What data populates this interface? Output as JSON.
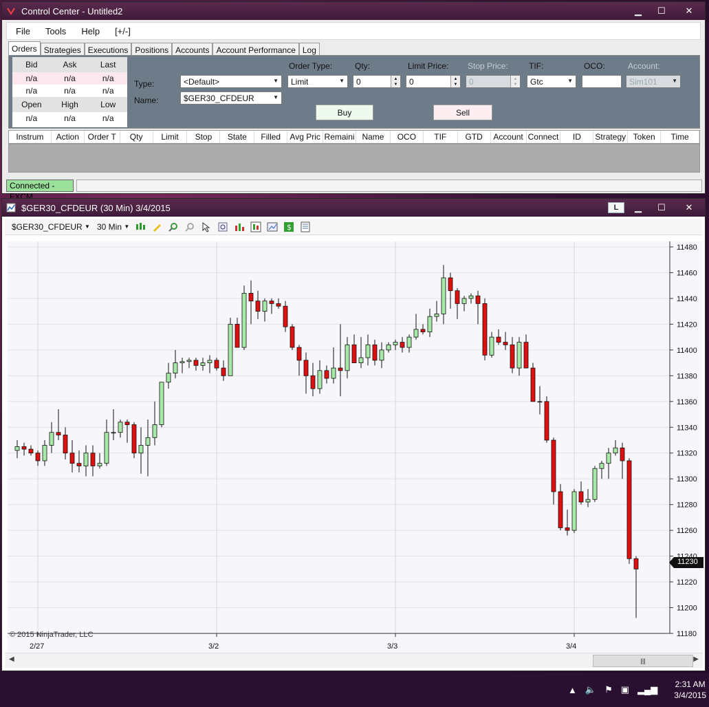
{
  "control_center": {
    "title": "Control Center - Untitled2",
    "menu": [
      "File",
      "Tools",
      "Help",
      "[+/-]"
    ],
    "tabs": [
      "Orders",
      "Strategies",
      "Executions",
      "Positions",
      "Accounts",
      "Account Performance",
      "Log"
    ],
    "active_tab": "Orders",
    "quote_headers": [
      "Bid",
      "Ask",
      "Last"
    ],
    "quote_row1": [
      "n/a",
      "n/a",
      "n/a"
    ],
    "quote_row2": [
      "n/a",
      "n/a",
      "n/a"
    ],
    "quote_headers2": [
      "Open",
      "High",
      "Low"
    ],
    "quote_row3": [
      "n/a",
      "n/a",
      "n/a"
    ],
    "type_label": "Type:",
    "type_value": "<Default>",
    "name_label": "Name:",
    "name_value": "$GER30_CFDEUR",
    "order_type_label": "Order Type:",
    "order_type_value": "Limit",
    "qty_label": "Qty:",
    "qty_value": "0",
    "limit_price_label": "Limit Price:",
    "limit_price_value": "0",
    "stop_price_label": "Stop Price:",
    "stop_price_value": "0",
    "tif_label": "TIF:",
    "tif_value": "Gtc",
    "oco_label": "OCO:",
    "oco_value": "",
    "account_label": "Account:",
    "account_value": "Sim101",
    "buy_label": "Buy",
    "sell_label": "Sell",
    "grid_columns": [
      "Instrum",
      "Action",
      "Order T",
      "Qty",
      "Limit",
      "Stop",
      "State",
      "Filled",
      "Avg Pric",
      "Remaini",
      "Name",
      "OCO",
      "TIF",
      "GTD",
      "Account",
      "Connect",
      "ID",
      "Strategy",
      "Token",
      "Time"
    ],
    "status_connected": "Connected - FXCM"
  },
  "chart_window": {
    "title": "$GER30_CFDEUR (30 Min)  3/4/2015",
    "l_button": "L",
    "instrument": "$GER30_CFDEUR",
    "interval": "30 Min",
    "copyright": "© 2015 NinjaTrader, LLC",
    "last_price_label": "11230"
  },
  "chart_data": {
    "type": "candlestick",
    "ylim": [
      11180,
      11480
    ],
    "yticks": [
      11180,
      11200,
      11220,
      11240,
      11260,
      11280,
      11300,
      11320,
      11340,
      11360,
      11380,
      11400,
      11420,
      11440,
      11460,
      11480
    ],
    "x_labels": [
      {
        "label": "2/27",
        "bar": 4
      },
      {
        "label": "3/2",
        "bar": 30
      },
      {
        "label": "3/3",
        "bar": 56
      },
      {
        "label": "3/4",
        "bar": 82
      }
    ],
    "candles": [
      [
        11322,
        11330,
        11316,
        11325
      ],
      [
        11325,
        11328,
        11318,
        11323
      ],
      [
        11323,
        11326,
        11318,
        11320
      ],
      [
        11320,
        11322,
        11310,
        11314
      ],
      [
        11314,
        11330,
        11310,
        11326
      ],
      [
        11326,
        11344,
        11320,
        11336
      ],
      [
        11336,
        11354,
        11330,
        11334
      ],
      [
        11334,
        11340,
        11315,
        11320
      ],
      [
        11320,
        11330,
        11305,
        11312
      ],
      [
        11312,
        11322,
        11305,
        11310
      ],
      [
        11310,
        11326,
        11302,
        11320
      ],
      [
        11320,
        11326,
        11302,
        11310
      ],
      [
        11310,
        11320,
        11308,
        11312
      ],
      [
        11312,
        11346,
        11310,
        11336
      ],
      [
        11336,
        11354,
        11330,
        11336
      ],
      [
        11336,
        11346,
        11332,
        11344
      ],
      [
        11344,
        11346,
        11328,
        11342
      ],
      [
        11342,
        11344,
        11316,
        11320
      ],
      [
        11320,
        11340,
        11304,
        11326
      ],
      [
        11326,
        11346,
        11302,
        11332
      ],
      [
        11332,
        11360,
        11326,
        11342
      ],
      [
        11342,
        11368,
        11340,
        11375
      ],
      [
        11375,
        11390,
        11370,
        11382
      ],
      [
        11382,
        11400,
        11378,
        11390
      ],
      [
        11390,
        11394,
        11382,
        11391
      ],
      [
        11391,
        11394,
        11386,
        11392
      ],
      [
        11392,
        11394,
        11384,
        11388
      ],
      [
        11388,
        11394,
        11384,
        11390
      ],
      [
        11390,
        11396,
        11382,
        11392
      ],
      [
        11392,
        11394,
        11384,
        11386
      ],
      [
        11386,
        11392,
        11376,
        11380
      ],
      [
        11380,
        11425,
        11396,
        11420
      ],
      [
        11420,
        11425,
        11402,
        11402
      ],
      [
        11402,
        11450,
        11400,
        11444
      ],
      [
        11444,
        11454,
        11420,
        11438
      ],
      [
        11438,
        11446,
        11424,
        11430
      ],
      [
        11430,
        11440,
        11422,
        11438
      ],
      [
        11438,
        11440,
        11428,
        11436
      ],
      [
        11436,
        11440,
        11432,
        11434
      ],
      [
        11434,
        11438,
        11414,
        11418
      ],
      [
        11418,
        11420,
        11400,
        11402
      ],
      [
        11402,
        11404,
        11380,
        11392
      ],
      [
        11392,
        11398,
        11366,
        11380
      ],
      [
        11380,
        11390,
        11364,
        11370
      ],
      [
        11370,
        11392,
        11366,
        11384
      ],
      [
        11384,
        11388,
        11374,
        11378
      ],
      [
        11378,
        11402,
        11374,
        11386
      ],
      [
        11386,
        11420,
        11364,
        11384
      ],
      [
        11384,
        11410,
        11378,
        11404
      ],
      [
        11404,
        11412,
        11396,
        11390
      ],
      [
        11390,
        11410,
        11386,
        11394
      ],
      [
        11394,
        11412,
        11388,
        11404
      ],
      [
        11404,
        11408,
        11388,
        11392
      ],
      [
        11392,
        11406,
        11386,
        11400
      ],
      [
        11400,
        11406,
        11398,
        11404
      ],
      [
        11404,
        11408,
        11400,
        11406
      ],
      [
        11406,
        11410,
        11398,
        11402
      ],
      [
        11402,
        11412,
        11398,
        11410
      ],
      [
        11410,
        11428,
        11408,
        11416
      ],
      [
        11416,
        11420,
        11412,
        11414
      ],
      [
        11414,
        11432,
        11410,
        11426
      ],
      [
        11426,
        11438,
        11422,
        11428
      ],
      [
        11428,
        11466,
        11420,
        11456
      ],
      [
        11456,
        11460,
        11432,
        11446
      ],
      [
        11446,
        11448,
        11424,
        11436
      ],
      [
        11436,
        11442,
        11430,
        11440
      ],
      [
        11440,
        11444,
        11436,
        11442
      ],
      [
        11442,
        11446,
        11420,
        11436
      ],
      [
        11436,
        11440,
        11392,
        11396
      ],
      [
        11396,
        11414,
        11394,
        11410
      ],
      [
        11410,
        11416,
        11404,
        11406
      ],
      [
        11406,
        11414,
        11400,
        11404
      ],
      [
        11404,
        11410,
        11382,
        11386
      ],
      [
        11386,
        11410,
        11380,
        11406
      ],
      [
        11406,
        11412,
        11386,
        11386
      ],
      [
        11386,
        11390,
        11366,
        11360
      ],
      [
        11360,
        11372,
        11350,
        11360
      ],
      [
        11360,
        11364,
        11328,
        11330
      ],
      [
        11330,
        11332,
        11280,
        11290
      ],
      [
        11290,
        11296,
        11260,
        11262
      ],
      [
        11262,
        11276,
        11256,
        11260
      ],
      [
        11260,
        11292,
        11258,
        11290
      ],
      [
        11290,
        11298,
        11280,
        11282
      ],
      [
        11282,
        11292,
        11278,
        11284
      ],
      [
        11284,
        11310,
        11282,
        11308
      ],
      [
        11308,
        11314,
        11300,
        11312
      ],
      [
        11312,
        11324,
        11300,
        11320
      ],
      [
        11320,
        11330,
        11318,
        11324
      ],
      [
        11324,
        11328,
        11300,
        11314
      ],
      [
        11314,
        11316,
        11234,
        11238
      ],
      [
        11238,
        11240,
        11192,
        11230
      ]
    ]
  }
}
